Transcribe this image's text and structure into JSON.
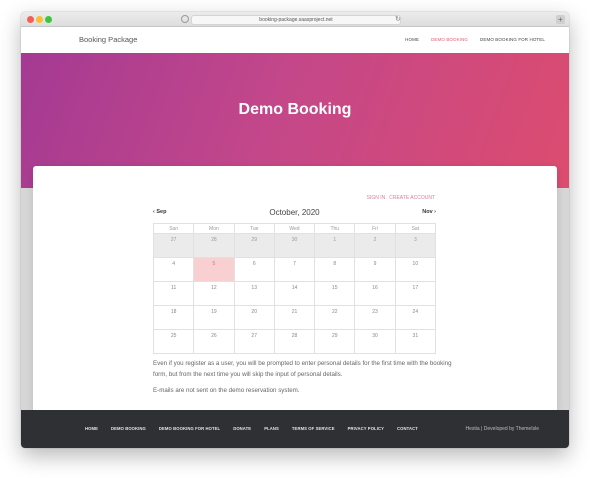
{
  "browser": {
    "url": "booking-package.saasproject.net"
  },
  "site": {
    "brand": "Booking Package",
    "nav": [
      "HOME",
      "DEMO BOOKING",
      "DEMO BOOKING FOR HOTEL"
    ],
    "active_nav_index": 1
  },
  "hero": {
    "title": "Demo Booking"
  },
  "auth": {
    "sign_in": "SIGN IN",
    "create_account": "CREATE ACCOUNT"
  },
  "calendar": {
    "prev_label": "Sep",
    "next_label": "Nov",
    "month_title": "October, 2020",
    "weekdays": [
      "Sun",
      "Mon",
      "Tue",
      "Wed",
      "Thu",
      "Fri",
      "Sat"
    ],
    "weeks": [
      [
        "27",
        "28",
        "29",
        "30",
        "1",
        "2",
        "3"
      ],
      [
        "4",
        "5",
        "6",
        "7",
        "8",
        "9",
        "10"
      ],
      [
        "11",
        "12",
        "13",
        "14",
        "15",
        "16",
        "17"
      ],
      [
        "18",
        "19",
        "20",
        "21",
        "22",
        "23",
        "24"
      ],
      [
        "25",
        "26",
        "27",
        "28",
        "29",
        "30",
        "31"
      ]
    ],
    "highlighted_day": "5"
  },
  "content": {
    "paragraph1": "Even if you register as a user, you will be prompted to enter personal details for the first time with the booking form, but from the next time you will skip the input of personal details.",
    "paragraph2": "E-mails are not sent on the demo reservation system."
  },
  "footer": {
    "links": [
      "HOME",
      "DEMO BOOKING",
      "DEMO BOOKING FOR HOTEL",
      "DONATE",
      "PLANS",
      "TERMS OF SERVICE",
      "PRIVACY POLICY",
      "CONTACT"
    ],
    "credit": "Hestia | Developed by ThemeIsle"
  },
  "colors": {
    "accent": "#e05b7a",
    "hero_start": "#a43a93",
    "hero_end": "#dc4c6f",
    "today_bg": "#f8d0d2",
    "footer_bg": "#2f3034"
  }
}
